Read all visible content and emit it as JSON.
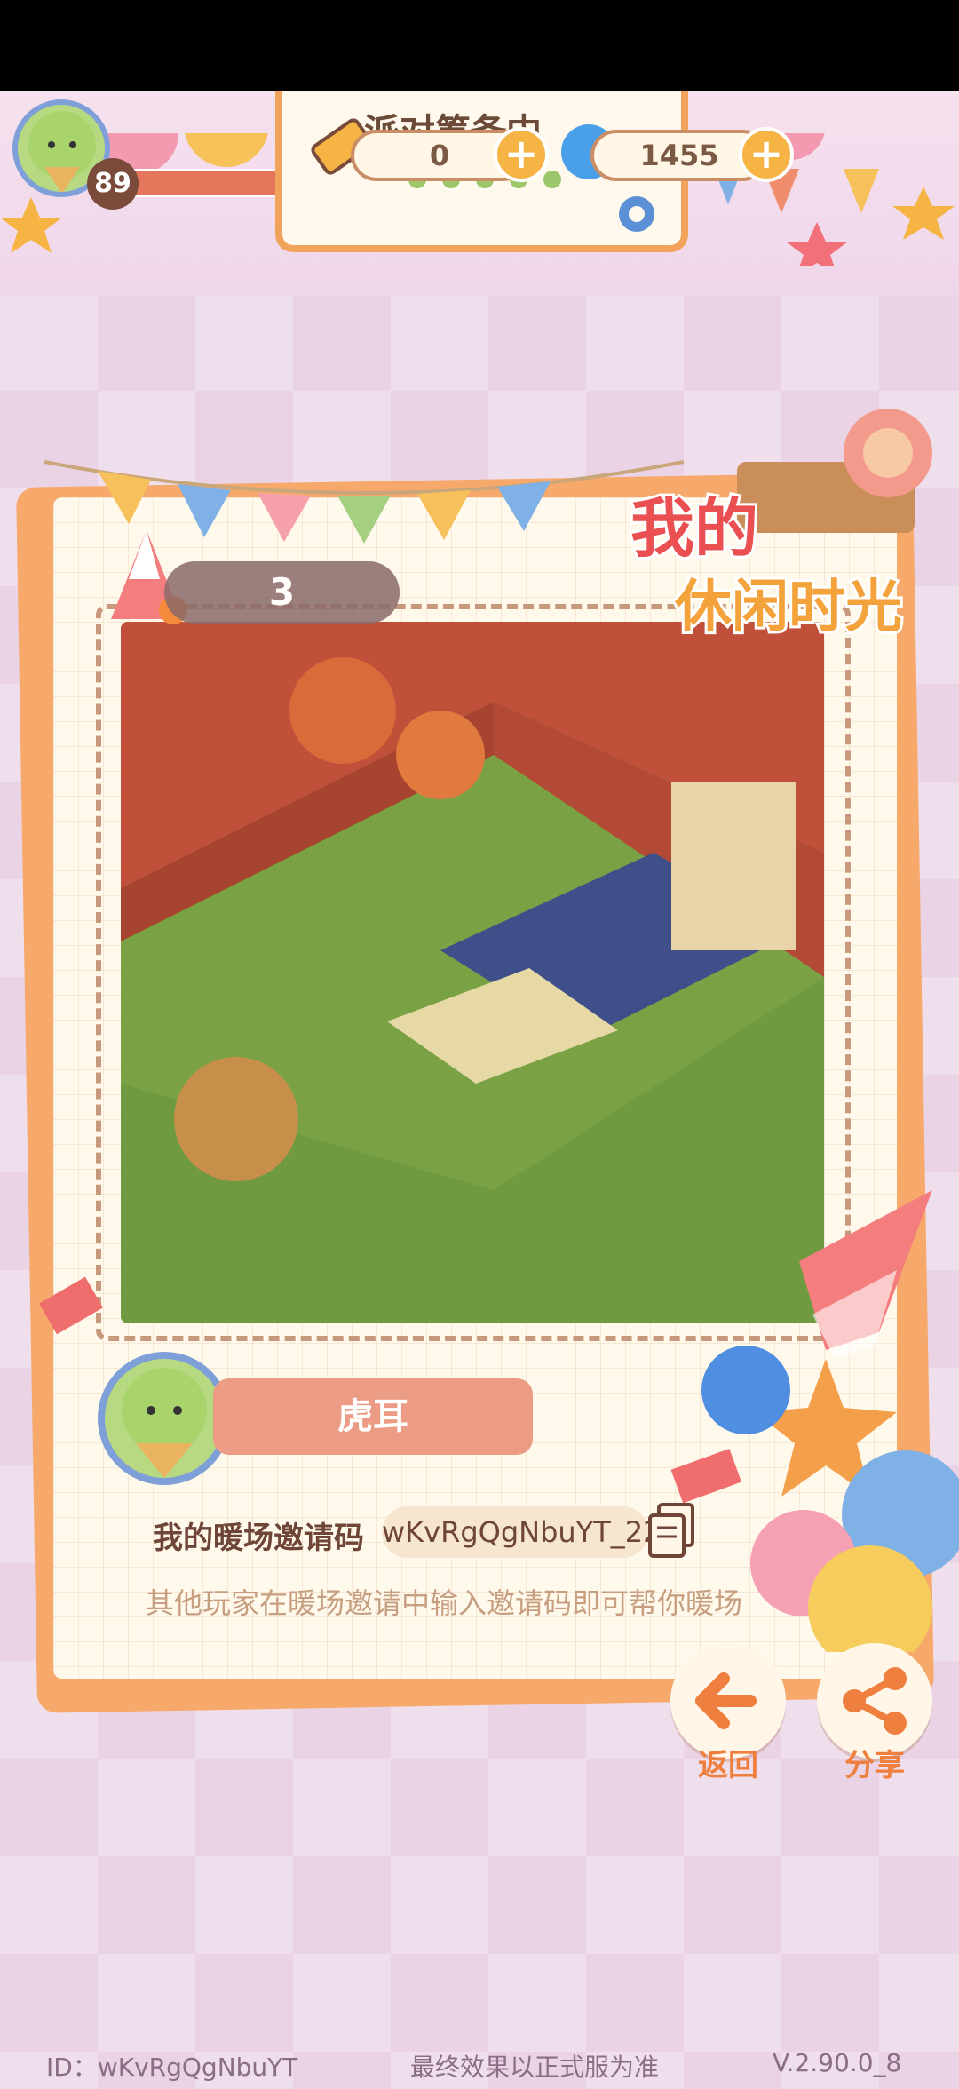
{
  "hud": {
    "level": "89",
    "panel_title": "派对筹备中",
    "tickets": "0",
    "coins": "1455"
  },
  "card": {
    "photo_count": "3",
    "logo_line1": "我的",
    "logo_line2": "休闲时光",
    "player_name": "虎耳",
    "invite_label": "我的暖场邀请码",
    "invite_code": "wKvRgQgNbuYT_22",
    "hint": "其他玩家在暖场邀请中输入邀请码即可帮你暖场"
  },
  "actions": {
    "back_label": "返回",
    "share_label": "分享"
  },
  "footer": {
    "id_text": "ID：wKvRgQgNbuYT",
    "disclaimer": "最终效果以正式服为准",
    "version": "V.2.90.0_8"
  },
  "colors": {
    "accent_orange": "#ef7f3f",
    "name_pill": "#ec9c84",
    "avatar_ring": "#7f9fd8"
  }
}
